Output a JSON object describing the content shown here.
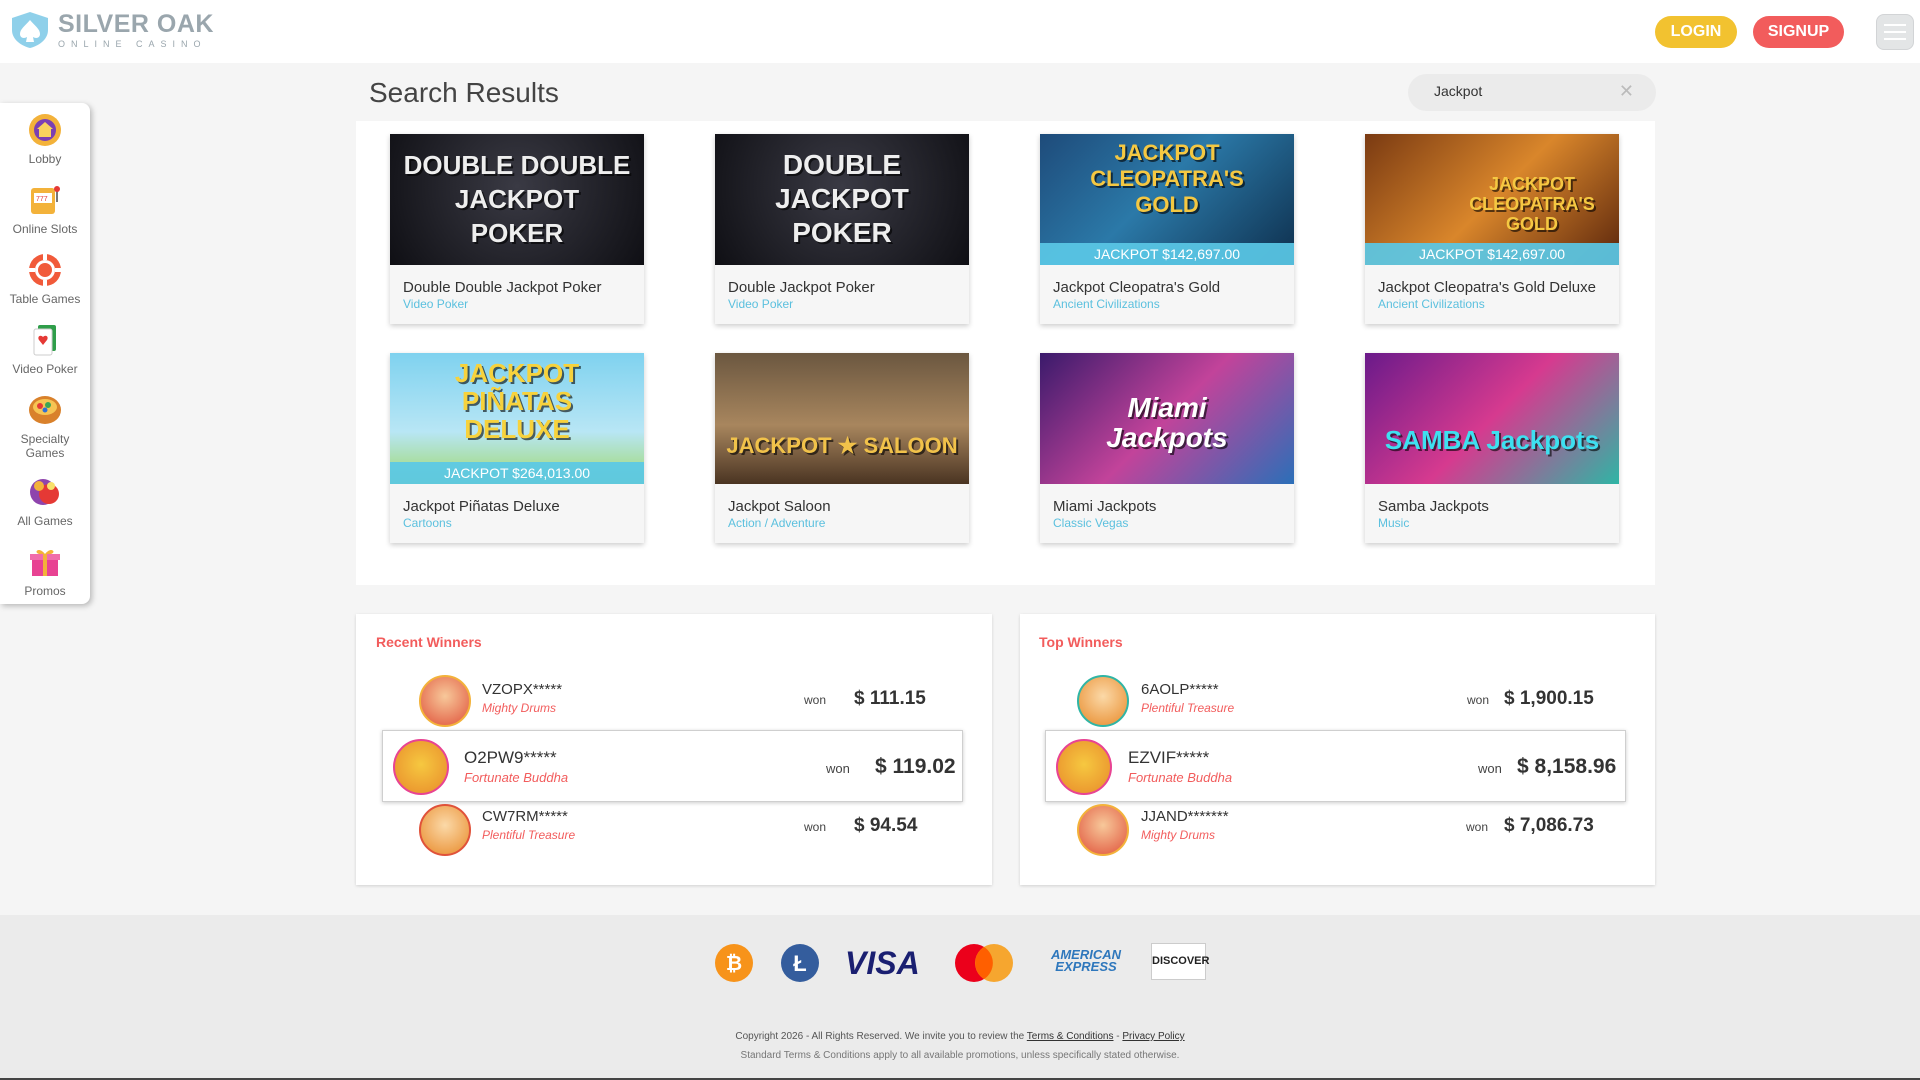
{
  "brand": {
    "title": "SILVER OAK",
    "subtitle": "ONLINE CASINO"
  },
  "header": {
    "login": "LOGIN",
    "signup": "SIGNUP"
  },
  "sidebar": {
    "items": [
      {
        "label": "Lobby",
        "icon": "lobby-icon"
      },
      {
        "label": "Online Slots",
        "icon": "slot-machine-icon"
      },
      {
        "label": "Table Games",
        "icon": "poker-chip-icon"
      },
      {
        "label": "Video Poker",
        "icon": "playing-card-icon"
      },
      {
        "label": "Specialty Games",
        "icon": "specialty-bowl-icon"
      },
      {
        "label": "All Games",
        "icon": "all-games-icon"
      },
      {
        "label": "Promos",
        "icon": "gift-icon"
      }
    ]
  },
  "main": {
    "title": "Search Results",
    "search": {
      "value": "Jackpot",
      "clear": "✕"
    }
  },
  "games": [
    {
      "name": "Double Double Jackpot Poker",
      "category": "Video Poker",
      "art": "DOUBLE DOUBLE\nJACKPOT\nPOKER",
      "jackpot": ""
    },
    {
      "name": "Double Jackpot Poker",
      "category": "Video Poker",
      "art": "DOUBLE\nJACKPOT\nPOKER",
      "jackpot": ""
    },
    {
      "name": "Jackpot Cleopatra's Gold",
      "category": "Ancient Civilizations",
      "art": "JACKPOT\nCLEOPATRA'S\nGOLD",
      "jackpot": "JACKPOT $142,697.00"
    },
    {
      "name": "Jackpot Cleopatra's Gold Deluxe",
      "category": "Ancient Civilizations",
      "art": "JACKPOT\nCLEOPATRA'S\nGOLD",
      "jackpot": "JACKPOT $142,697.00"
    },
    {
      "name": "Jackpot Piñatas Deluxe",
      "category": "Cartoons",
      "art": "JACKPOT\nPIÑATAS\nDELUXE",
      "jackpot": "JACKPOT $264,013.00"
    },
    {
      "name": "Jackpot Saloon",
      "category": "Action / Adventure",
      "art": "JACKPOT ★ SALOON",
      "jackpot": ""
    },
    {
      "name": "Miami Jackpots",
      "category": "Classic Vegas",
      "art": "Miami\nJackpots",
      "jackpot": ""
    },
    {
      "name": "Samba Jackpots",
      "category": "Music",
      "art": "SAMBA Jackpots",
      "jackpot": ""
    }
  ],
  "recent_winners": {
    "title": "Recent Winners",
    "won_label": "won",
    "rows": [
      {
        "name": "VZOPX*****",
        "game": "Mighty Drums",
        "amount": "$ 111.15"
      },
      {
        "name": "O2PW9*****",
        "game": "Fortunate Buddha",
        "amount": "$ 119.02"
      },
      {
        "name": "CW7RM*****",
        "game": "Plentiful Treasure",
        "amount": "$ 94.54"
      }
    ]
  },
  "top_winners": {
    "title": "Top Winners",
    "won_label": "won",
    "rows": [
      {
        "name": "6AOLP*****",
        "game": "Plentiful Treasure",
        "amount": "$ 1,900.15"
      },
      {
        "name": "EZVIF*****",
        "game": "Fortunate Buddha",
        "amount": "$ 8,158.96"
      },
      {
        "name": "JJAND*******",
        "game": "Mighty Drums",
        "amount": "$ 7,086.73"
      }
    ]
  },
  "footer": {
    "payments": [
      "bitcoin-icon",
      "litecoin-icon",
      "VISA",
      "mastercard-icon",
      "AMERICAN EXPRESS",
      "DISCOVER"
    ],
    "copyright_prefix": "Copyright 2026 - All Rights Reserved. We invite you to review the ",
    "terms_link": "Terms & Conditions",
    "separator": " - ",
    "privacy_link": "Privacy Policy",
    "disclaimer": "Standard Terms & Conditions apply to all available promotions, unless specifically stated otherwise."
  },
  "colors": {
    "accent_red": "#f25c5c",
    "accent_yellow": "#f2c230",
    "accent_blue": "#5bc0de"
  }
}
